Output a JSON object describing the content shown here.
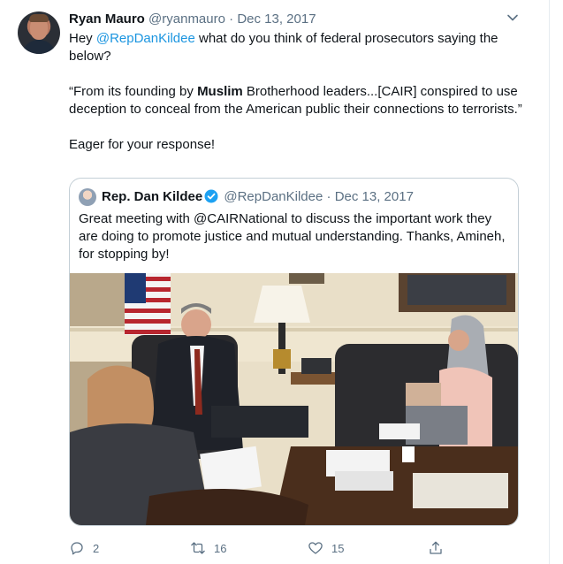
{
  "tweet": {
    "author_name": "Ryan Mauro",
    "author_handle": "@ryanmauro",
    "separator": "·",
    "date": "Dec 13, 2017",
    "text_intro_prefix": "Hey ",
    "mention": "@RepDanKildee",
    "text_intro_suffix": " what do you think of federal prosecutors saying the below?",
    "quote_prefix": "“From its founding by ",
    "quote_bold": "Muslim",
    "quote_suffix": " Brotherhood leaders...[CAIR] conspired to use deception to conceal from the American public their connections to terrorists.”",
    "closing": "Eager for your response!"
  },
  "quoted_tweet": {
    "author_name": "Rep. Dan Kildee",
    "author_handle": "@RepDanKildee",
    "separator": "·",
    "date": "Dec 13, 2017",
    "text": "Great meeting with @CAIRNational to discuss the important work they are doing to promote justice and mutual understanding. Thanks, Amineh, for stopping by!"
  },
  "actions": {
    "reply_count": "2",
    "retweet_count": "16",
    "like_count": "15"
  },
  "icons": {
    "menu": "chevron-down-icon",
    "verified": "verified-badge-icon",
    "reply": "reply-icon",
    "retweet": "retweet-icon",
    "like": "like-icon",
    "share": "share-icon"
  },
  "colors": {
    "link": "#1b95e0",
    "muted": "#5b7083",
    "verified": "#1da1f2",
    "border": "#c4cfd6"
  }
}
